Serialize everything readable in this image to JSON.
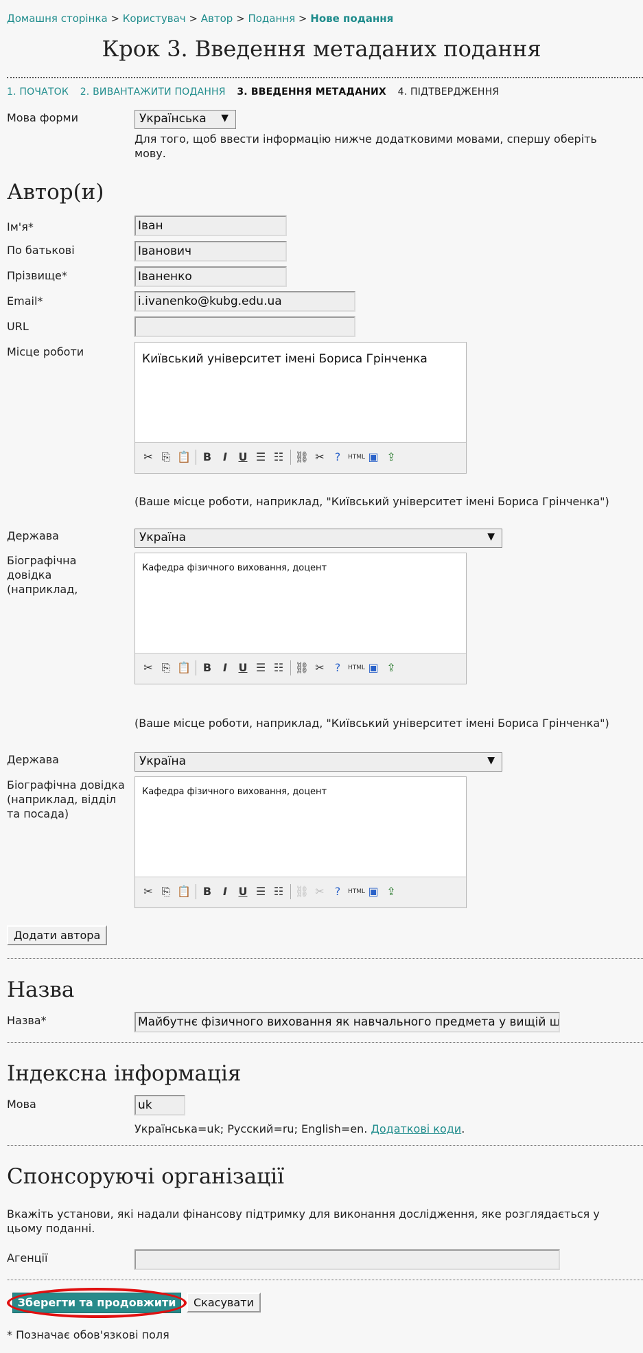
{
  "breadcrumb": {
    "home": "Домашня сторінка",
    "user": "Користувач",
    "author": "Автор",
    "submissions": "Подання",
    "current": "Нове подання",
    "separator": ">"
  },
  "page_title": "Крок 3. Введення метаданих подання",
  "steps": [
    "1. ПОЧАТОК",
    "2. ВИВАНТАЖИТИ ПОДАННЯ",
    "3. ВВЕДЕННЯ МЕТАДАНИХ",
    "4. ПІДТВЕРДЖЕННЯ"
  ],
  "form_language": {
    "label": "Мова форми",
    "value": "Українська",
    "help": "Для того, щоб ввести інформацію нижче додатковими мовами, спершу оберіть мову."
  },
  "authors": {
    "heading": "Автор(и)",
    "first_name_label": "Ім'я*",
    "first_name": "Іван",
    "middle_name_label": "По батькові",
    "middle_name": "Іванович",
    "last_name_label": "Прізвище*",
    "last_name": "Іваненко",
    "email_label": "Email*",
    "email": "i.ivanenko@kubg.edu.ua",
    "url_label": "URL",
    "url": "",
    "affiliation_label": "Місце роботи",
    "affiliation": "Київський університет імені Бориса Грінченка",
    "affiliation_help": "(Ваше місце роботи, наприклад, \"Київський університет імені Бориса Грінченка\")",
    "country_label": "Держава",
    "country": "Україна",
    "bio_label_1": "Біографічна довідка (наприклад,",
    "bio_1": "Кафедра фізичного виховання, доцент",
    "affiliation_help_2": "(Ваше місце роботи, наприклад, \"Київський університет імені Бориса Грінченка\")",
    "country_label_2": "Держава",
    "country_2": "Україна",
    "bio_label_2": "Біографічна довідка (наприклад, відділ та посада)",
    "bio_2": "Кафедра фізичного виховання, доцент",
    "add_author": "Додати автора"
  },
  "title_section": {
    "heading": "Назва",
    "label": "Назва*",
    "value": "Майбутнє фізичного виховання як навчального предмета у вищій школі"
  },
  "index_section": {
    "heading": "Індексна інформація",
    "language_label": "Мова",
    "language_value": "uk",
    "language_help": "Українська=uk; Русский=ru; English=en.",
    "more_codes": "Додаткові коди",
    "period": "."
  },
  "sponsors": {
    "heading": "Спонсоруючі організації",
    "description": "Вкажіть установи, які надали фінансову підтримку для виконання дослідження, яке розглядається у цьому поданні.",
    "agencies_label": "Агенції",
    "agencies_value": ""
  },
  "actions": {
    "save": "Зберегти та продовжити",
    "cancel": "Скасувати"
  },
  "required_note": "* Позначає обов'язкові поля",
  "colors": {
    "accent": "#1f8c8c",
    "save_button": "#288a8a",
    "highlight_ring": "#e01010"
  }
}
